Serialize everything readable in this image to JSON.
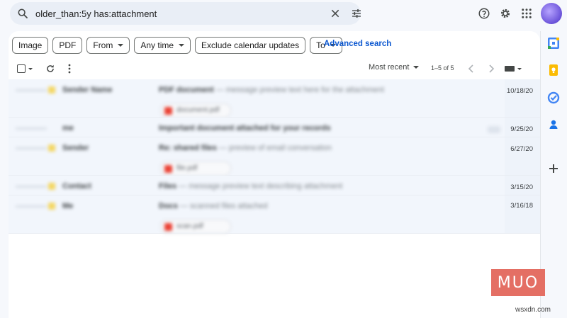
{
  "search": {
    "value": "older_than:5y has:attachment"
  },
  "filters": {
    "chips": [
      {
        "label": "Image",
        "dropdown": false
      },
      {
        "label": "PDF",
        "dropdown": false
      },
      {
        "label": "From",
        "dropdown": true
      },
      {
        "label": "Any time",
        "dropdown": true
      },
      {
        "label": "Exclude calendar updates",
        "dropdown": false
      },
      {
        "label": "To",
        "dropdown": true
      }
    ],
    "advanced_search": "Advanced search"
  },
  "toolbar": {
    "sort_label": "Most recent",
    "range": "1–5 of 5"
  },
  "emails": [
    {
      "sender": "Sender Name",
      "subject_bold": "PDF document",
      "snippet": " — message preview text here for the attachment",
      "attachment": "document.pdf",
      "date": "10/18/20"
    },
    {
      "sender": "me",
      "subject_bold": "Important document attached for your records",
      "snippet": "",
      "attachment": "",
      "date": "9/25/20"
    },
    {
      "sender": "Sender",
      "subject_bold": "Re: shared files",
      "snippet": " — preview of email conversation",
      "attachment": "file.pdf",
      "date": "6/27/20"
    },
    {
      "sender": "Contact",
      "subject_bold": "Files",
      "snippet": " — message preview text describing attachment",
      "attachment": "",
      "date": "3/15/20"
    },
    {
      "sender": "Me",
      "subject_bold": "Docs",
      "snippet": " — scanned files attached",
      "attachment": "scan.pdf",
      "date": "3/16/18"
    }
  ],
  "watermark": {
    "logo": "MUO",
    "site": "wsxdn.com"
  },
  "colors": {
    "accent": "#0b57d0",
    "list_bg": "#f2f6fc",
    "logo": "#e46f64"
  }
}
